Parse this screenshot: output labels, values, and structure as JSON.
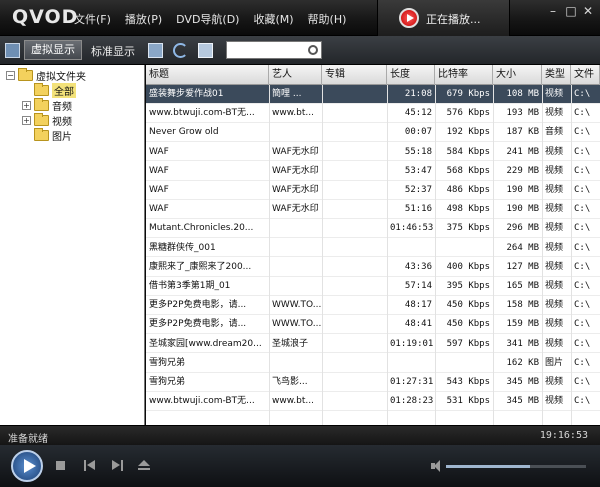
{
  "app": {
    "logo": "QVOD",
    "menu": [
      "文件(F)",
      "播放(P)",
      "DVD导航(D)",
      "收藏(M)",
      "帮助(H)"
    ],
    "now_playing": "正在播放..."
  },
  "toolbar": {
    "tab_virtual": "虚拟显示",
    "tab_standard": "标准显示",
    "search_value": ""
  },
  "sidebar": {
    "root": "虚拟文件夹",
    "items": [
      "全部",
      "音频",
      "视频",
      "图片"
    ],
    "selected": "全部"
  },
  "table": {
    "columns": [
      "标题",
      "艺人",
      "专辑",
      "长度",
      "比特率",
      "大小",
      "类型",
      "文件"
    ],
    "rows": [
      {
        "title": "盛装舞步爱作战01",
        "artist": "簡哩  ...",
        "album": "",
        "length": "21:08",
        "bitrate": "679 Kbps",
        "size": "108 MB",
        "type": "视频",
        "file": "C:\\"
      },
      {
        "title": "www.btwuji.com-BT无...",
        "artist": "www.bt...",
        "album": "",
        "length": "45:12",
        "bitrate": "576 Kbps",
        "size": "193 MB",
        "type": "视频",
        "file": "C:\\"
      },
      {
        "title": "Never Grow old",
        "artist": "",
        "album": "",
        "length": "00:07",
        "bitrate": "192 Kbps",
        "size": "187 KB",
        "type": "音频",
        "file": "C:\\"
      },
      {
        "title": "WAF",
        "artist": "WAF无水印",
        "album": "",
        "length": "55:18",
        "bitrate": "584 Kbps",
        "size": "241 MB",
        "type": "视频",
        "file": "C:\\"
      },
      {
        "title": "WAF",
        "artist": "WAF无水印",
        "album": "",
        "length": "53:47",
        "bitrate": "568 Kbps",
        "size": "229 MB",
        "type": "视频",
        "file": "C:\\"
      },
      {
        "title": "WAF",
        "artist": "WAF无水印",
        "album": "",
        "length": "52:37",
        "bitrate": "486 Kbps",
        "size": "190 MB",
        "type": "视频",
        "file": "C:\\"
      },
      {
        "title": "WAF",
        "artist": "WAF无水印",
        "album": "",
        "length": "51:16",
        "bitrate": "498 Kbps",
        "size": "190 MB",
        "type": "视频",
        "file": "C:\\"
      },
      {
        "title": "Mutant.Chronicles.20...",
        "artist": "",
        "album": "",
        "length": "01:46:53",
        "bitrate": "375 Kbps",
        "size": "296 MB",
        "type": "视频",
        "file": "C:\\"
      },
      {
        "title": "黑糖群侠传_001",
        "artist": "",
        "album": "",
        "length": "",
        "bitrate": "",
        "size": "264 MB",
        "type": "视频",
        "file": "C:\\"
      },
      {
        "title": "康熙来了_康熙来了200...",
        "artist": "",
        "album": "",
        "length": "43:36",
        "bitrate": "400 Kbps",
        "size": "127 MB",
        "type": "视频",
        "file": "C:\\"
      },
      {
        "title": "借书第3季第1期_01",
        "artist": "",
        "album": "",
        "length": "57:14",
        "bitrate": "395 Kbps",
        "size": "165 MB",
        "type": "视频",
        "file": "C:\\"
      },
      {
        "title": "更多P2P免费电影，请...",
        "artist": "WWW.TO...",
        "album": "",
        "length": "48:17",
        "bitrate": "450 Kbps",
        "size": "158 MB",
        "type": "视频",
        "file": "C:\\"
      },
      {
        "title": "更多P2P免费电影，请...",
        "artist": "WWW.TO...",
        "album": "",
        "length": "48:41",
        "bitrate": "450 Kbps",
        "size": "159 MB",
        "type": "视频",
        "file": "C:\\"
      },
      {
        "title": "圣城家园[www.dream20...",
        "artist": "圣城浪子",
        "album": "",
        "length": "01:19:01",
        "bitrate": "597 Kbps",
        "size": "341 MB",
        "type": "视频",
        "file": "C:\\"
      },
      {
        "title": "雪狗兄弟",
        "artist": "",
        "album": "",
        "length": "",
        "bitrate": "",
        "size": "162 KB",
        "type": "图片",
        "file": "C:\\"
      },
      {
        "title": "雪狗兄弟",
        "artist": "飞鸟影...",
        "album": "",
        "length": "01:27:31",
        "bitrate": "543 Kbps",
        "size": "345 MB",
        "type": "视频",
        "file": "C:\\"
      },
      {
        "title": "www.btwuji.com-BT无...",
        "artist": "www.bt...",
        "album": "",
        "length": "01:28:23",
        "bitrate": "531 Kbps",
        "size": "345 MB",
        "type": "视频",
        "file": "C:\\"
      }
    ]
  },
  "status": {
    "text": "准备就绪",
    "time": "19:16:53"
  },
  "player": {
    "volume_fraction": 0.6
  },
  "colors": {
    "accent": "#3b4a5b",
    "folder": "#f3d15d",
    "now_playing_red": "#c40000"
  }
}
